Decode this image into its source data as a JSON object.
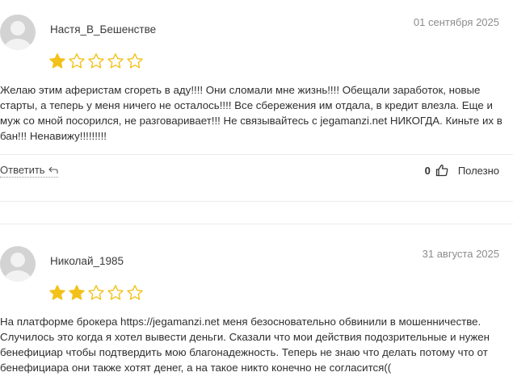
{
  "colors": {
    "star_filled": "#f2c21b",
    "star_empty_stroke": "#f2c21b",
    "divider": "#ebebeb",
    "date": "#8c8c8c"
  },
  "reviews": [
    {
      "author": "Настя_В_Бешенстве",
      "date": "01 сентября 2025",
      "rating": 1,
      "max_rating": 5,
      "text": "Желаю этим аферистам сгореть в аду!!!! Они сломали мне жизнь!!!! Обещали заработок, новые старты, а теперь у меня ничего не осталось!!!! Все сбережения им отдала, в кредит влезла. Еще и муж со мной посорился, не разговаривает!!! Не связывайтесь с jegamanzi.net НИКОГДА. Киньте их в бан!!! Ненавижу!!!!!!!!!",
      "reply_label": "Ответить",
      "likes_count": "0",
      "useful_label": "Полезно"
    },
    {
      "author": "Николай_1985",
      "date": "31 августа 2025",
      "rating": 2,
      "max_rating": 5,
      "text": "На платформе брокера https://jegamanzi.net меня безосновательно обвинили в мошенничестве. Случилось это когда я хотел вывести деньги. Сказали что мои действия подозрительные и нужен бенефициар чтобы подтвердить мою благонадежность. Теперь не знаю что делать потому что от бенефициара они также хотят денег, а на такое никто конечно не согласится(("
    }
  ]
}
